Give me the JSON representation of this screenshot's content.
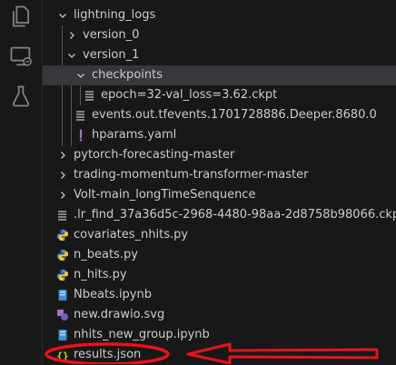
{
  "activity_bar": {
    "icons": [
      "explorer-icon",
      "remote-explorer-icon",
      "testing-icon"
    ]
  },
  "explorer": {
    "items": [
      {
        "label": "lightning_logs",
        "kind": "folder-open",
        "depth": 0
      },
      {
        "label": "version_0",
        "kind": "folder-closed",
        "depth": 1
      },
      {
        "label": "version_1",
        "kind": "folder-open",
        "depth": 1
      },
      {
        "label": "checkpoints",
        "kind": "folder-open",
        "depth": 2,
        "selected": true
      },
      {
        "label": "epoch=32-val_loss=3.62.ckpt",
        "kind": "file-lines",
        "depth": 3
      },
      {
        "label": "events.out.tfevents.1701728886.Deeper.8680.0",
        "kind": "file-lines",
        "depth": 2
      },
      {
        "label": "hparams.yaml",
        "kind": "file-yaml",
        "depth": 2
      },
      {
        "label": "pytorch-forecasting-master",
        "kind": "folder-closed",
        "depth": 0
      },
      {
        "label": "trading-momentum-transformer-master",
        "kind": "folder-closed",
        "depth": 0
      },
      {
        "label": "Volt-main_longTimeSenquence",
        "kind": "folder-closed",
        "depth": 0
      },
      {
        "label": ".lr_find_37a36d5c-2968-4480-98aa-2d8758b98066.ckpt",
        "kind": "file-lines",
        "depth": 0
      },
      {
        "label": "covariates_nhits.py",
        "kind": "file-python",
        "depth": 0
      },
      {
        "label": "n_beats.py",
        "kind": "file-python",
        "depth": 0
      },
      {
        "label": "n_hits.py",
        "kind": "file-python",
        "depth": 0
      },
      {
        "label": "Nbeats.ipynb",
        "kind": "file-notebook",
        "depth": 0
      },
      {
        "label": "new.drawio.svg",
        "kind": "file-svg",
        "depth": 0
      },
      {
        "label": "nhits_new_group.ipynb",
        "kind": "file-notebook",
        "depth": 0
      },
      {
        "label": "results.json",
        "kind": "file-json",
        "depth": 0
      }
    ]
  },
  "annotation": {
    "color": "#e8121a",
    "marks": [
      "highlight-ellipse",
      "pointer-arrow"
    ]
  }
}
